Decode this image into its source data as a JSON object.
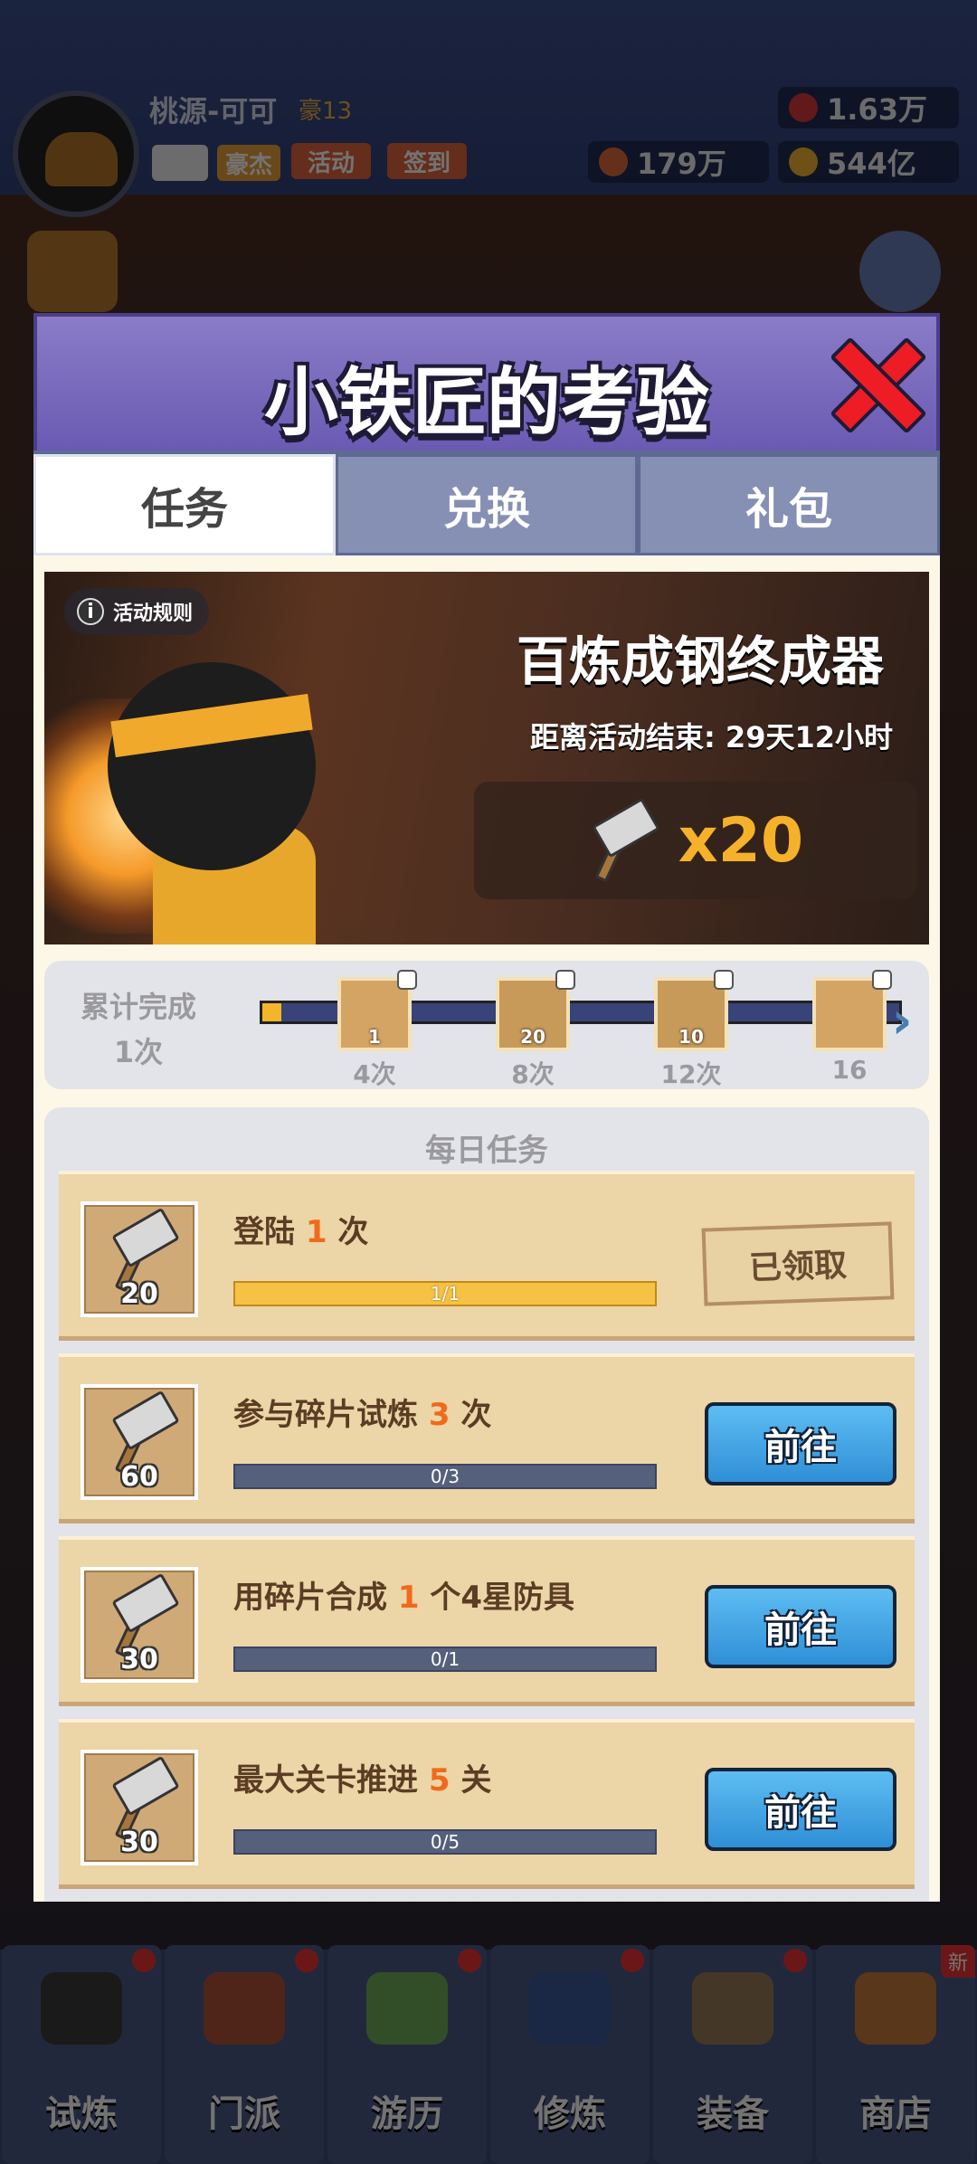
{
  "background": {
    "player_name": "桃源-可可",
    "vip_label": "豪13",
    "top_buttons": {
      "hero": "豪杰",
      "event": "活动",
      "checkin": "签到"
    },
    "resources": {
      "gems": "1.63万",
      "tokens": "179万",
      "coins": "544亿"
    },
    "bottom_nav": [
      {
        "label": "试炼",
        "dot": true
      },
      {
        "label": "门派",
        "dot": true
      },
      {
        "label": "游历",
        "dot": true
      },
      {
        "label": "修炼",
        "dot": true
      },
      {
        "label": "装备",
        "dot": true
      },
      {
        "label": "商店",
        "badge": "新"
      }
    ]
  },
  "modal": {
    "title": "小铁匠的考验",
    "tabs": [
      {
        "label": "任务",
        "active": true
      },
      {
        "label": "兑换",
        "active": false
      },
      {
        "label": "礼包",
        "active": false
      }
    ],
    "banner": {
      "rules_label": "活动规则",
      "title": "百炼成钢终成器",
      "countdown": "距离活动结束: 29天12小时",
      "reward_icon": "hammer-icon",
      "reward_qty": "x20"
    },
    "progress": {
      "label_line1": "累计完成",
      "label_line2": "1次",
      "fraction": 0.03,
      "milestones": [
        {
          "label": "4次",
          "qty": "1",
          "icon": "scroll-icon"
        },
        {
          "label": "8次",
          "qty": "20",
          "icon": "mystery-armor-icon"
        },
        {
          "label": "12次",
          "qty": "10",
          "icon": "mystery-weapon-icon"
        },
        {
          "label": "16",
          "qty": "",
          "icon": "scroll-icon"
        }
      ]
    },
    "daily": {
      "title": "每日任务",
      "tasks": [
        {
          "pre": "登陆 ",
          "num": "1",
          "post": " 次",
          "reward": "20",
          "progress": "1/1",
          "done": true,
          "button": "已领取"
        },
        {
          "pre": "参与碎片试炼 ",
          "num": "3",
          "post": " 次",
          "reward": "60",
          "progress": "0/3",
          "done": false,
          "button": "前往"
        },
        {
          "pre": "用碎片合成 ",
          "num": "1",
          "post": " 个4星防具",
          "reward": "30",
          "progress": "0/1",
          "done": false,
          "button": "前往"
        },
        {
          "pre": "最大关卡推进 ",
          "num": "5",
          "post": " 关",
          "reward": "30",
          "progress": "0/5",
          "done": false,
          "button": "前往"
        }
      ]
    }
  }
}
